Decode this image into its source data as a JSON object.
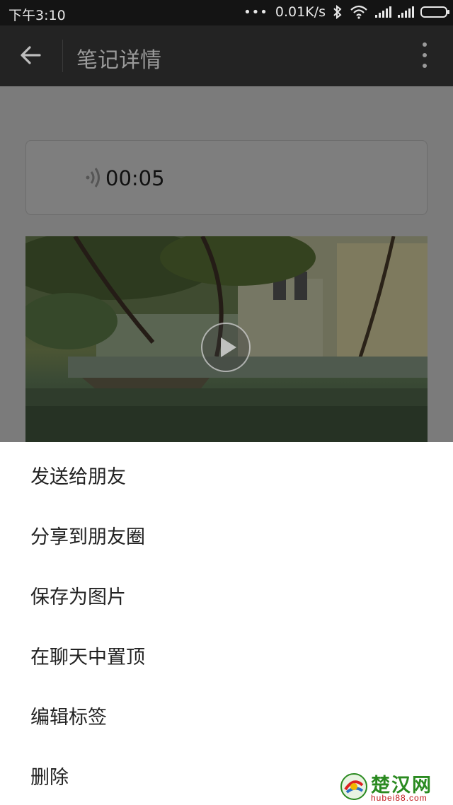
{
  "status_bar": {
    "time": "下午3:10",
    "more": "•••",
    "speed": "0.01K/s"
  },
  "app_bar": {
    "title": "笔记详情"
  },
  "note": {
    "voice_duration": "00:05"
  },
  "action_sheet": {
    "items": [
      "发送给朋友",
      "分享到朋友圈",
      "保存为图片",
      "在聊天中置顶",
      "编辑标签",
      "删除"
    ]
  },
  "watermark": {
    "name": "楚汉网",
    "url": "hubei88.com"
  },
  "colors": {
    "status_bar": "#141414",
    "app_bar": "#232323",
    "dim_overlay": "#7b7b7b",
    "sheet": "#ffffff"
  }
}
